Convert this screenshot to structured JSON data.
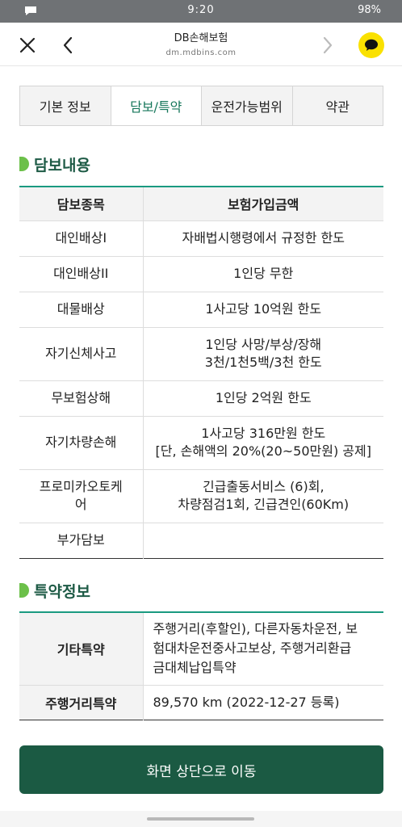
{
  "status_bar": {
    "time": "9:20",
    "battery": "98%"
  },
  "browser": {
    "title": "DB손해보험",
    "url": "dm.mdbins.com"
  },
  "tabs": [
    {
      "label": "기본 정보",
      "active": false
    },
    {
      "label": "담보/특약",
      "active": true
    },
    {
      "label": "운전가능범위",
      "active": false
    },
    {
      "label": "약관",
      "active": false
    }
  ],
  "coverage": {
    "heading": "담보내용",
    "headers": [
      "담보종목",
      "보험가입금액"
    ],
    "rows": [
      {
        "item": "대인배상I",
        "amount": "자배법시행령에서 규정한 한도"
      },
      {
        "item": "대인배상II",
        "amount": "1인당 무한"
      },
      {
        "item": "대물배상",
        "amount": "1사고당 10억원 한도"
      },
      {
        "item": "자기신체사고",
        "amount": "1인당 사망/부상/장해\n3천/1천5백/3천 한도"
      },
      {
        "item": "무보험상해",
        "amount": "1인당 2억원 한도"
      },
      {
        "item": "자기차량손해",
        "amount": "1사고당 316만원 한도\n[단, 손해액의 20%(20~50만원) 공제]"
      },
      {
        "item": "프로미카오토케\n어",
        "amount": "긴급출동서비스 (6)회,\n차량점검1회, 긴급견인(60Km)"
      },
      {
        "item": "부가담보",
        "amount": ""
      }
    ]
  },
  "special": {
    "heading": "특약정보",
    "rows": [
      {
        "label": "기타특약",
        "value": "주행거리(후할인), 다른자동차운전, 보\n험대차운전중사고보상, 주행거리환급\n금대체납입특약"
      },
      {
        "label": "주행거리특약",
        "value": "89,570 km (2022-12-27 등록)"
      }
    ]
  },
  "scroll_top_label": "화면 상단으로 이동",
  "colors": {
    "accent": "#15765a",
    "button": "#1b5a43",
    "marker": "#6cc04a",
    "kakao": "#fae100"
  }
}
